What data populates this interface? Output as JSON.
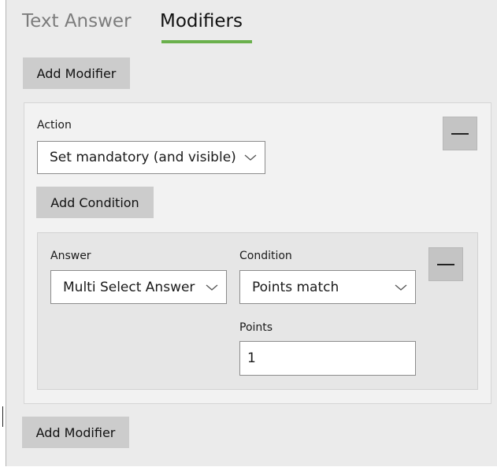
{
  "tabs": [
    {
      "label": "Text Answer",
      "active": false
    },
    {
      "label": "Modifiers",
      "active": true
    }
  ],
  "accent_color": "#6ab04c",
  "add_modifier_label": "Add Modifier",
  "modifier": {
    "action_label": "Action",
    "action_value": "Set mandatory (and visible)",
    "add_condition_label": "Add Condition",
    "condition": {
      "answer_label": "Answer",
      "answer_value": "Multi Select Answer",
      "condition_label": "Condition",
      "condition_value": "Points match",
      "points_label": "Points",
      "points_value": "1"
    }
  },
  "icons": [
    "chevron-down-icon",
    "minus-icon"
  ]
}
